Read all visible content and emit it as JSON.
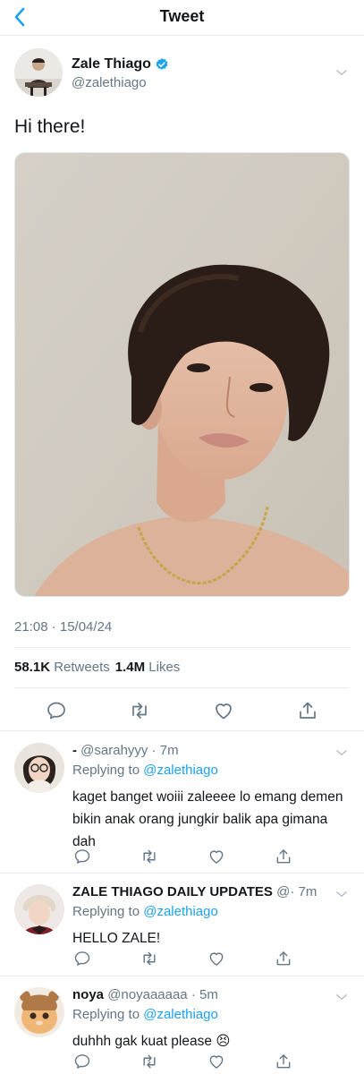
{
  "header": {
    "title": "Tweet"
  },
  "tweet": {
    "author_name": "Zale Thiago",
    "author_handle": "@zalethiago",
    "text": "Hi there!",
    "timestamp": "21:08 · 15/04/24",
    "retweets_count": "58.1K",
    "retweets_label": "Retweets",
    "likes_count": "1.4M",
    "likes_label": "Likes"
  },
  "replies": [
    {
      "name": "-",
      "handle": "@sarahyyy",
      "time": "· 7m",
      "replying_prefix": "Replying to",
      "replying_to": "@zalethiago",
      "text": "kaget banget woiii zaleeee lo emang demen bikin anak orang jungkir balik apa gimana dah"
    },
    {
      "name": "ZALE THIAGO DAILY UPDATES",
      "handle": "@",
      "time": "· 7m",
      "replying_prefix": "Replying to",
      "replying_to": "@zalethiago",
      "text": "HELLO ZALE!"
    },
    {
      "name": "noya",
      "handle": "@noyaaaaaa",
      "time": "· 5m",
      "replying_prefix": "Replying to",
      "replying_to": "@zalethiago",
      "text": "duhhh gak kuat please 😣"
    }
  ],
  "colors": {
    "accent": "#1da1f2",
    "text": "#14171a",
    "secondary": "#657786",
    "divider": "#e6ecf0"
  },
  "icons": [
    "back-arrow-icon",
    "verified-badge-icon",
    "chevron-down-icon",
    "reply-icon",
    "retweet-icon",
    "like-icon",
    "share-icon"
  ]
}
